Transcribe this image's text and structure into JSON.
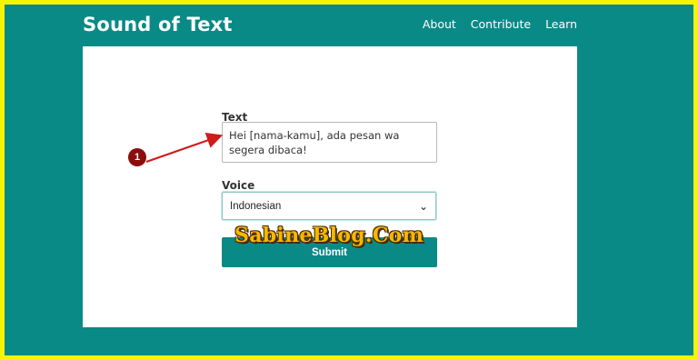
{
  "header": {
    "title": "Sound of Text",
    "nav": [
      "About",
      "Contribute",
      "Learn"
    ]
  },
  "form": {
    "text_label": "Text",
    "text_value": "Hei [nama-kamu], ada pesan wa segera dibaca!",
    "voice_label": "Voice",
    "voice_value": "Indonesian",
    "submit_label": "Submit"
  },
  "annotation": {
    "marker": "1"
  },
  "watermark": "SabineBlog.Com",
  "colors": {
    "teal": "#0a8a87",
    "frame": "#f7f400",
    "marker": "#8b0d0d",
    "arrow": "#d11a1a"
  },
  "icons": {
    "select_chevron": "chevron-down-icon"
  }
}
